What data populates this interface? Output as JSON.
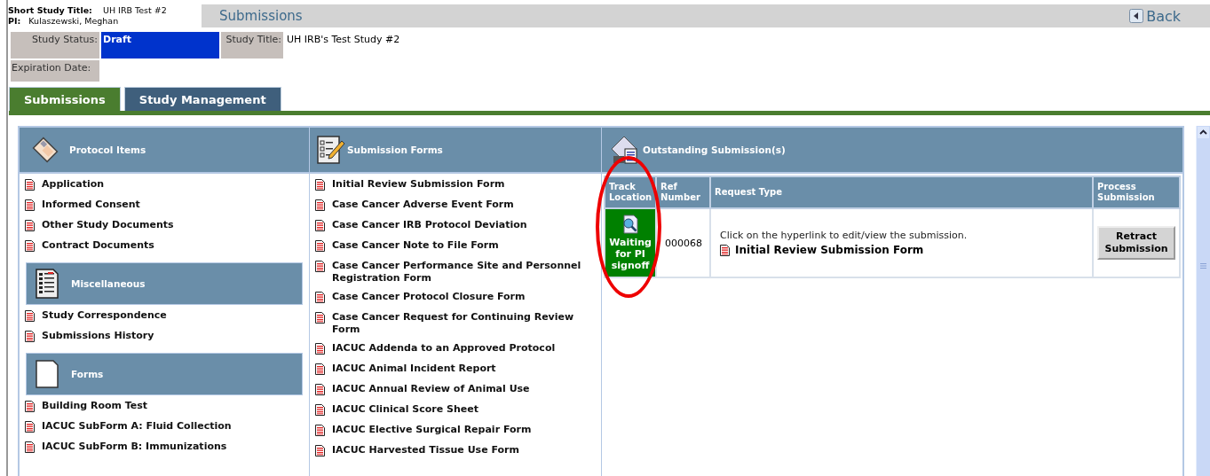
{
  "header": {
    "short_title_label": "Short Study Title:",
    "short_title": "UH IRB Test #2",
    "pi_label": "PI:",
    "pi": "Kulaszewski, Meghan",
    "page_title": "Submissions",
    "back": "Back"
  },
  "study_info": {
    "status_label": "Study Status:",
    "status": "Draft",
    "title_label": "Study Title:",
    "title": "UH IRB's Test Study #2",
    "expiration_label": "Expiration Date:"
  },
  "tabs": [
    {
      "label": "Submissions",
      "selected": true
    },
    {
      "label": "Study Management",
      "selected": false
    }
  ],
  "protocol_panel": {
    "sections": [
      {
        "title": "Protocol Items",
        "kind": "protocol",
        "items": [
          "Application",
          "Informed Consent",
          "Other Study Documents",
          "Contract Documents"
        ]
      },
      {
        "title": "Miscellaneous",
        "kind": "list",
        "items": [
          "Study Correspondence",
          "Submissions History"
        ]
      },
      {
        "title": "Forms",
        "kind": "page",
        "items": [
          "Building Room Test",
          "IACUC SubForm A: Fluid Collection",
          "IACUC SubForm B: Immunizations"
        ]
      }
    ]
  },
  "submission_forms": {
    "title": "Submission Forms",
    "items": [
      "Initial Review Submission Form",
      "Case Cancer Adverse Event Form",
      "Case Cancer IRB Protocol Deviation",
      "Case Cancer Note to File Form",
      "Case Cancer Performance Site and Personnel Registration Form",
      "Case Cancer Protocol Closure Form",
      "Case Cancer Request for Continuing Review Form",
      "IACUC Addenda to an Approved Protocol",
      "IACUC Animal Incident Report",
      "IACUC Annual Review of Animal Use",
      "IACUC Clinical Score Sheet",
      "IACUC Elective Surgical Repair Form",
      "IACUC Harvested Tissue Use Form"
    ]
  },
  "outstanding": {
    "title": "Outstanding Submission(s)",
    "columns": [
      "Track Location",
      "Ref Number",
      "Request Type",
      "Process Submission"
    ],
    "rows": [
      {
        "track_location": "Waiting for PI signoff",
        "ref_number": "000068",
        "instruction": "Click on the hyperlink to edit/view the submission.",
        "form_link": "Initial Review Submission Form",
        "action": "Retract Submission"
      }
    ]
  }
}
